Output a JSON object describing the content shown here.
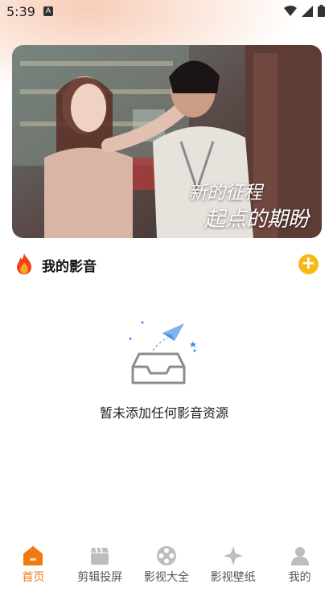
{
  "status_bar": {
    "time": "5:39",
    "notification_glyph": "A"
  },
  "banner": {
    "caption_line1": "新的征程",
    "caption_line2": "起点的期盼"
  },
  "section": {
    "title": "我的影音",
    "icon": "fire-icon",
    "add_icon": "plus-icon"
  },
  "empty_state": {
    "message": "暂未添加任何影音资源",
    "icon": "empty-tray-icon"
  },
  "tabs": [
    {
      "label": "首页",
      "icon": "home-icon",
      "active": true
    },
    {
      "label": "剪辑投屏",
      "icon": "clapperboard-icon",
      "active": false
    },
    {
      "label": "影视大全",
      "icon": "film-reel-icon",
      "active": false
    },
    {
      "label": "影视壁纸",
      "icon": "star-diamond-icon",
      "active": false
    },
    {
      "label": "我的",
      "icon": "user-icon",
      "active": false
    }
  ],
  "colors": {
    "accent": "#f07a12",
    "add_button": "#f7b918",
    "tab_inactive": "#555555"
  }
}
